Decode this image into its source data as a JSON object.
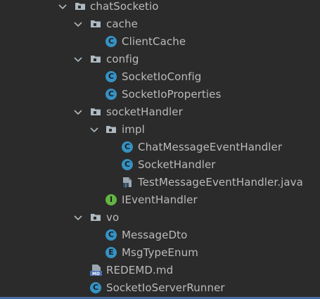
{
  "tree": {
    "nodes": [
      {
        "label": "chatSocketio",
        "type": "folder",
        "expanded": true,
        "icon": "folder-icon"
      },
      {
        "label": "cache",
        "type": "folder",
        "expanded": true,
        "icon": "folder-icon"
      },
      {
        "label": "ClientCache",
        "type": "class",
        "icon": "class-icon",
        "badge": "C"
      },
      {
        "label": "config",
        "type": "folder",
        "expanded": true,
        "icon": "folder-icon"
      },
      {
        "label": "SocketIoConfig",
        "type": "class",
        "icon": "class-icon",
        "badge": "C"
      },
      {
        "label": "SocketIoProperties",
        "type": "class",
        "icon": "class-icon",
        "badge": "C"
      },
      {
        "label": "socketHandler",
        "type": "folder",
        "expanded": true,
        "icon": "folder-icon"
      },
      {
        "label": "impl",
        "type": "folder",
        "expanded": true,
        "icon": "folder-icon"
      },
      {
        "label": "ChatMessageEventHandler",
        "type": "class",
        "icon": "class-icon",
        "badge": "C"
      },
      {
        "label": "SocketHandler",
        "type": "class",
        "icon": "class-icon",
        "badge": "C"
      },
      {
        "label": "TestMessageEventHandler.java",
        "type": "java-file",
        "icon": "java-file-icon"
      },
      {
        "label": "IEventHandler",
        "type": "interface",
        "icon": "interface-icon",
        "badge": "I"
      },
      {
        "label": "vo",
        "type": "folder",
        "expanded": true,
        "icon": "folder-icon"
      },
      {
        "label": "MessageDto",
        "type": "class",
        "icon": "class-icon",
        "badge": "C"
      },
      {
        "label": "MsgTypeEnum",
        "type": "enum",
        "icon": "enum-icon",
        "badge": "E"
      },
      {
        "label": "REDEMD.md",
        "type": "markdown",
        "icon": "markdown-file-icon",
        "badge": "MD"
      },
      {
        "label": "SocketIoServerRunner",
        "type": "class",
        "icon": "class-icon",
        "badge": "C"
      }
    ]
  },
  "colors": {
    "background": "#2b2b2b",
    "text": "#bbbbbb",
    "class_icon": "#3592c4",
    "interface_icon": "#62b543",
    "folder_icon": "#aeb9c0",
    "chevron": "#aeb9c0"
  }
}
